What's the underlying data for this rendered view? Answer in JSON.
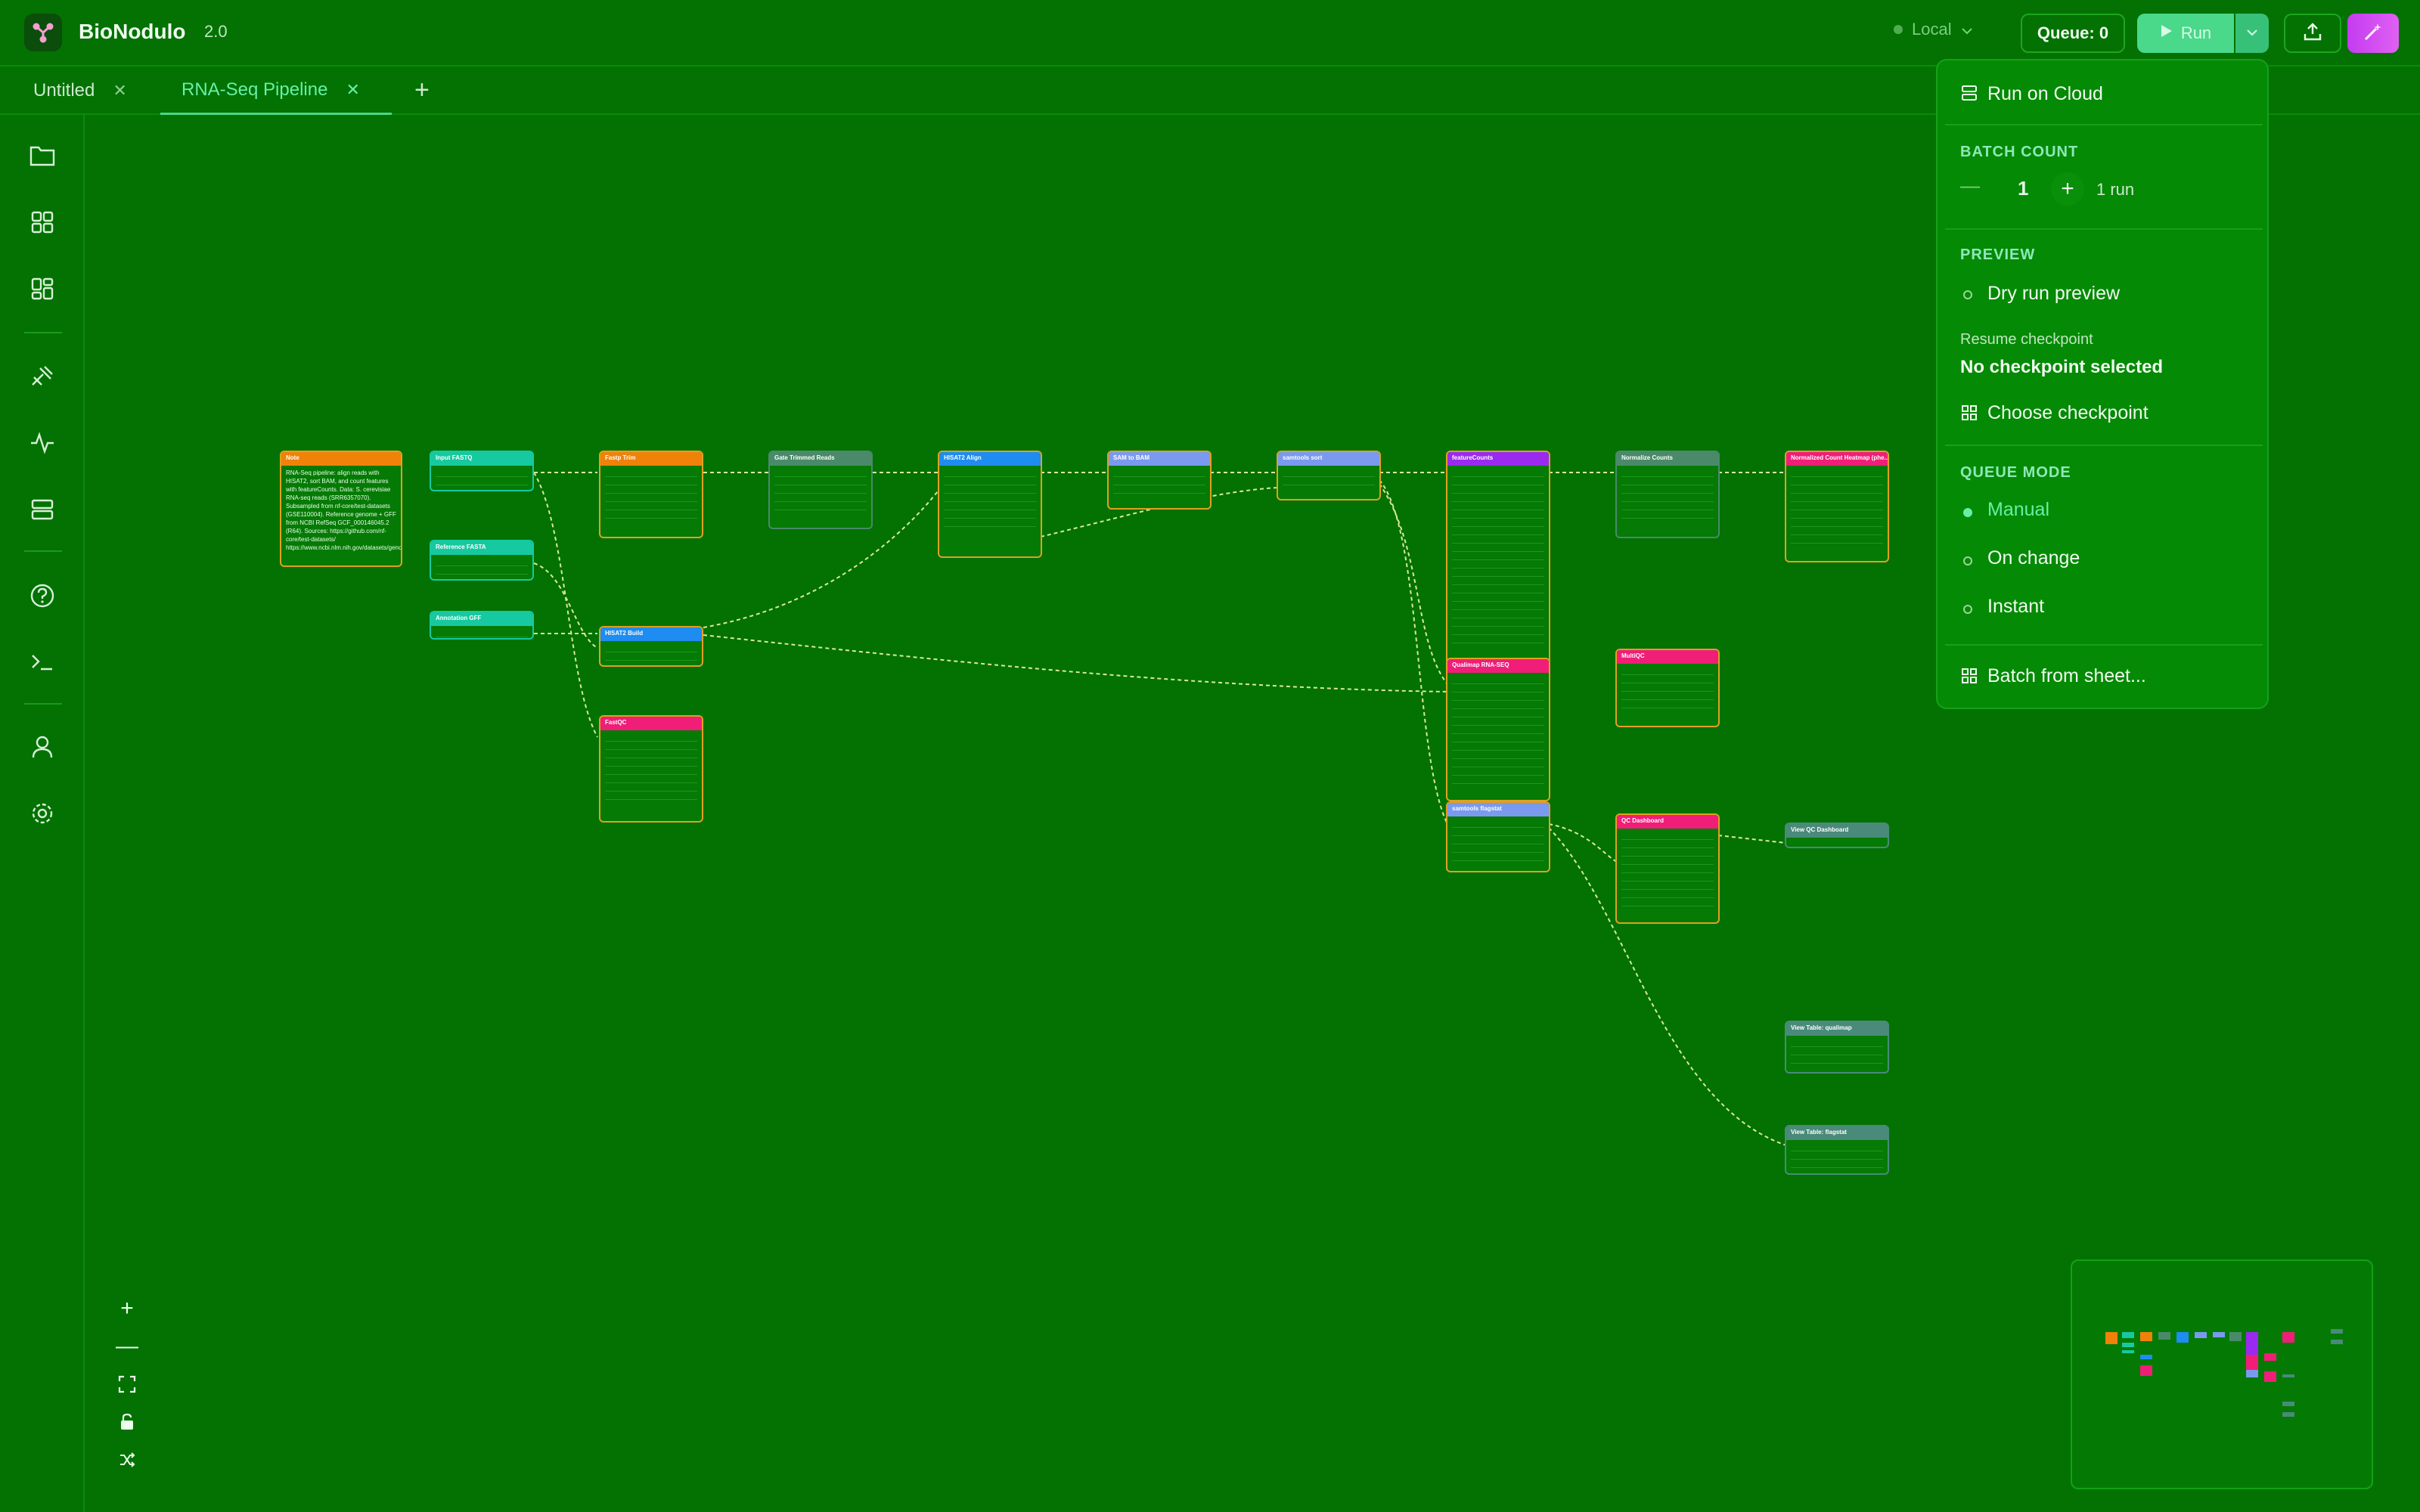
{
  "app": {
    "name": "BioNodulo",
    "version": "2.0"
  },
  "topbar": {
    "environment": "Local",
    "queue_label": "Queue: 0",
    "run_label": "Run"
  },
  "tabs": [
    {
      "label": "Untitled",
      "active": false
    },
    {
      "label": "RNA-Seq Pipeline",
      "active": true
    }
  ],
  "sidebar": {
    "icons": [
      "folder-icon",
      "grid-icon",
      "dashboard-icon",
      "tools-icon",
      "activity-icon",
      "server-icon",
      "help-icon",
      "terminal-icon",
      "user-icon",
      "settings-icon"
    ]
  },
  "run_menu": {
    "run_on_cloud": "Run on Cloud",
    "batch_count_title": "BATCH COUNT",
    "batch_count_value": "1",
    "batch_count_suffix": "1 run",
    "preview_title": "PREVIEW",
    "dry_run": "Dry run preview",
    "resume_label": "Resume checkpoint",
    "resume_value": "No checkpoint selected",
    "choose_checkpoint": "Choose checkpoint",
    "queue_mode_title": "QUEUE MODE",
    "queue_modes": [
      {
        "label": "Manual",
        "selected": true
      },
      {
        "label": "On change",
        "selected": false
      },
      {
        "label": "Instant",
        "selected": false
      }
    ],
    "batch_from_sheet": "Batch from sheet..."
  },
  "colors": {
    "background": "#037203",
    "accent": "#4ad88a",
    "active_text": "#66f0a6",
    "node_border": "#e0a020"
  },
  "nodes": [
    {
      "title": "Note",
      "color": "#f0820a",
      "text": "RNA-Seq pipeline: align reads with HISAT2, sort BAM, and count features with featureCounts. Data: S. cerevisiae RNA-seq reads (SRR6357070). Subsampled from nf-core/test-datasets (GSE110004). Reference genome + GFF from NCBI RefSeq GCF_000146045.2 (R64). Sources: https://github.com/nf-core/test-datasets/ https://www.ncbi.nlm.nih.gov/datasets/genome/GCF_0"
    },
    {
      "title": "Input FASTQ",
      "color": "#17c9a0"
    },
    {
      "title": "Reference FASTA",
      "color": "#17c9a0"
    },
    {
      "title": "Annotation GFF",
      "color": "#17c9a0"
    },
    {
      "title": "Fastp Trim",
      "color": "#f0820a"
    },
    {
      "title": "HISAT2 Build",
      "color": "#1e8cf0"
    },
    {
      "title": "FastQC",
      "color": "#f01e78"
    },
    {
      "title": "Gate Trimmed Reads",
      "color": "#4a8a6a"
    },
    {
      "title": "HISAT2 Align",
      "color": "#1e8cf0"
    },
    {
      "title": "SAM to BAM",
      "color": "#7a9af0"
    },
    {
      "title": "samtools sort",
      "color": "#7a9af0"
    },
    {
      "title": "featureCounts",
      "color": "#9a2af0"
    },
    {
      "title": "Qualimap RNA-SEQ",
      "color": "#f01e78"
    },
    {
      "title": "samtools flagstat",
      "color": "#7a9af0"
    },
    {
      "title": "Normalize Counts",
      "color": "#4a8a6a"
    },
    {
      "title": "MultiQC",
      "color": "#f01e78"
    },
    {
      "title": "QC Dashboard",
      "color": "#f01e78"
    },
    {
      "title": "Normalized Count Heatmap (phe...",
      "color": "#f01e78"
    },
    {
      "title": "View QC Dashboard",
      "color": "#4a8a7a"
    },
    {
      "title": "View Table: qualimap",
      "color": "#4a8a7a"
    },
    {
      "title": "View Table: flagstat",
      "color": "#4a8a7a"
    }
  ]
}
